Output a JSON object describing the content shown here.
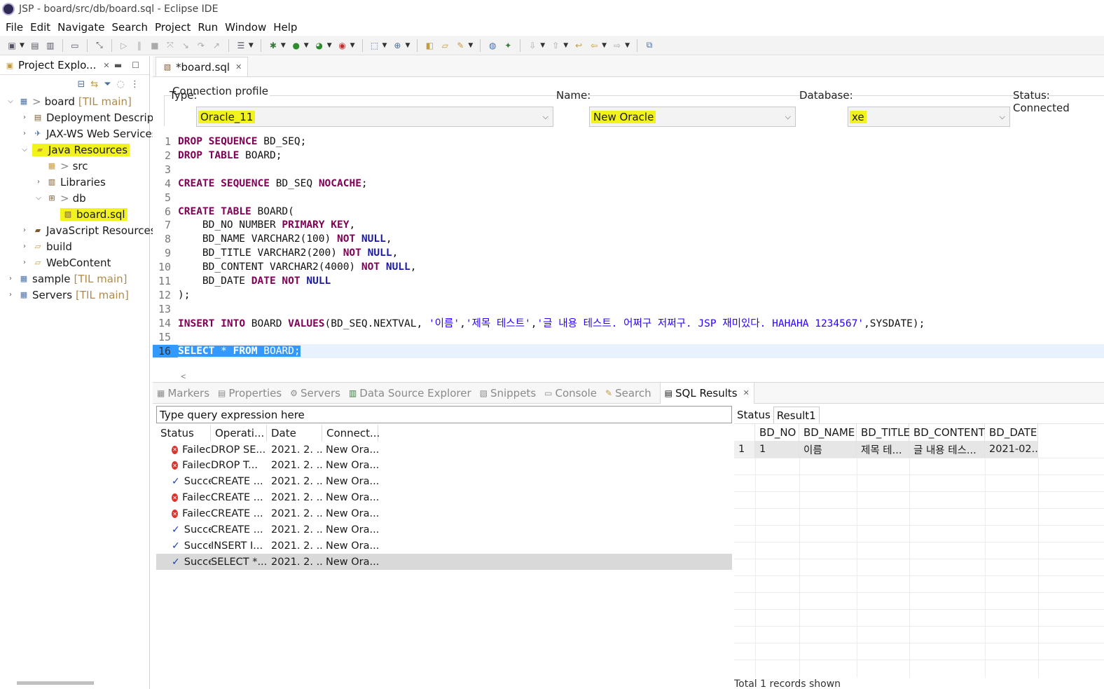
{
  "window": {
    "title": "JSP - board/src/db/board.sql - Eclipse IDE"
  },
  "menu": [
    "File",
    "Edit",
    "Navigate",
    "Search",
    "Project",
    "Run",
    "Window",
    "Help"
  ],
  "project_explorer": {
    "tab_label": "Project Explo...",
    "tree": [
      {
        "label": "board",
        "decoration": "[TIL main]",
        "prefix": ">",
        "twisty": "open",
        "icon": "project-icon"
      },
      {
        "label": "Deployment Descript",
        "twisty": "closed",
        "icon": "deployment-descriptor-icon"
      },
      {
        "label": "JAX-WS Web Services",
        "twisty": "closed",
        "icon": "web-services-icon"
      },
      {
        "label": "Java Resources",
        "twisty": "open",
        "icon": "java-resources-icon",
        "highlighted": true
      },
      {
        "label": "src",
        "prefix": ">",
        "twisty": "none",
        "icon": "source-folder-icon"
      },
      {
        "label": "Libraries",
        "twisty": "closed",
        "icon": "libraries-icon"
      },
      {
        "label": "db",
        "prefix": ">",
        "twisty": "open",
        "icon": "package-icon"
      },
      {
        "label": "board.sql",
        "twisty": "none",
        "icon": "sql-file-icon",
        "highlighted": true
      },
      {
        "label": "JavaScript Resources",
        "twisty": "closed",
        "icon": "javascript-resources-icon"
      },
      {
        "label": "build",
        "twisty": "closed",
        "icon": "folder-icon"
      },
      {
        "label": "WebContent",
        "twisty": "closed",
        "icon": "folder-icon"
      },
      {
        "label": "sample",
        "decoration": "[TIL main]",
        "twisty": "closed",
        "icon": "project-icon"
      },
      {
        "label": "Servers",
        "decoration": "[TIL main]",
        "twisty": "closed",
        "icon": "servers-project-icon"
      }
    ]
  },
  "editor": {
    "tab_label": "*board.sql",
    "connection_profile": {
      "group_label": "Connection profile",
      "type_label": "Type:",
      "type_value": "Oracle_11",
      "name_label": "Name:",
      "name_value": "New Oracle",
      "database_label": "Database:",
      "database_value": "xe",
      "status_text": "Status: Connected"
    },
    "lines": [
      "DROP SEQUENCE BD_SEQ;",
      "DROP TABLE BOARD;",
      "",
      "CREATE SEQUENCE BD_SEQ NOCACHE;",
      "",
      "CREATE TABLE BOARD(",
      "    BD_NO NUMBER PRIMARY KEY,",
      "    BD_NAME VARCHAR2(100) NOT NULL,",
      "    BD_TITLE VARCHAR2(200) NOT NULL,",
      "    BD_CONTENT VARCHAR2(4000) NOT NULL,",
      "    BD_DATE DATE NOT NULL",
      ");",
      "",
      "INSERT INTO BOARD VALUES(BD_SEQ.NEXTVAL, '이름','제목 테스트','글 내용 테스트. 어쩌구 저쩌구. JSP 재미있다. HAHAHA 1234567',SYSDATE);",
      "",
      "SELECT * FROM BOARD;"
    ]
  },
  "bottom_panel": {
    "tabs": [
      "Markers",
      "Properties",
      "Servers",
      "Data Source Explorer",
      "Snippets",
      "Console",
      "Search",
      "SQL Results"
    ],
    "query_placeholder": "Type query expression here",
    "history_columns": [
      "Status",
      "Operati...",
      "Date",
      "Connect..."
    ],
    "history_rows": [
      {
        "status": "fail",
        "status_text": "Failec",
        "operation": "DROP SE...",
        "date": "2021. 2. ...",
        "connection": "New Ora..."
      },
      {
        "status": "fail",
        "status_text": "Failec",
        "operation": "DROP T...",
        "date": "2021. 2. ...",
        "connection": "New Ora..."
      },
      {
        "status": "ok",
        "status_text": "Succe",
        "operation": "CREATE ...",
        "date": "2021. 2. ...",
        "connection": "New Ora..."
      },
      {
        "status": "fail",
        "status_text": "Failec",
        "operation": "CREATE ...",
        "date": "2021. 2. ...",
        "connection": "New Ora..."
      },
      {
        "status": "fail",
        "status_text": "Failec",
        "operation": "CREATE ...",
        "date": "2021. 2. ...",
        "connection": "New Ora..."
      },
      {
        "status": "ok",
        "status_text": "Succe",
        "operation": "CREATE ...",
        "date": "2021. 2. ...",
        "connection": "New Ora..."
      },
      {
        "status": "ok",
        "status_text": "Succe",
        "operation": "INSERT I...",
        "date": "2021. 2. ...",
        "connection": "New Ora..."
      },
      {
        "status": "ok",
        "status_text": "Succe",
        "operation": "SELECT *...",
        "date": "2021. 2. ...",
        "connection": "New Ora...",
        "selected": true
      }
    ],
    "result_tabs": [
      "Status",
      "Result1"
    ],
    "result_columns": [
      "BD_NO",
      "BD_NAME",
      "BD_TITLE",
      "BD_CONTENT",
      "BD_DATE"
    ],
    "result_rows": [
      {
        "rownum": "1",
        "cells": [
          "1",
          "이름",
          "제목 테...",
          "글 내용 테스...",
          "2021-02..."
        ]
      }
    ],
    "records_shown": "Total 1 records shown"
  },
  "colors": {
    "highlight": "#f2f21c",
    "keyword": "#7f0055",
    "string": "#2a00ff",
    "selection": "#3399ff"
  }
}
